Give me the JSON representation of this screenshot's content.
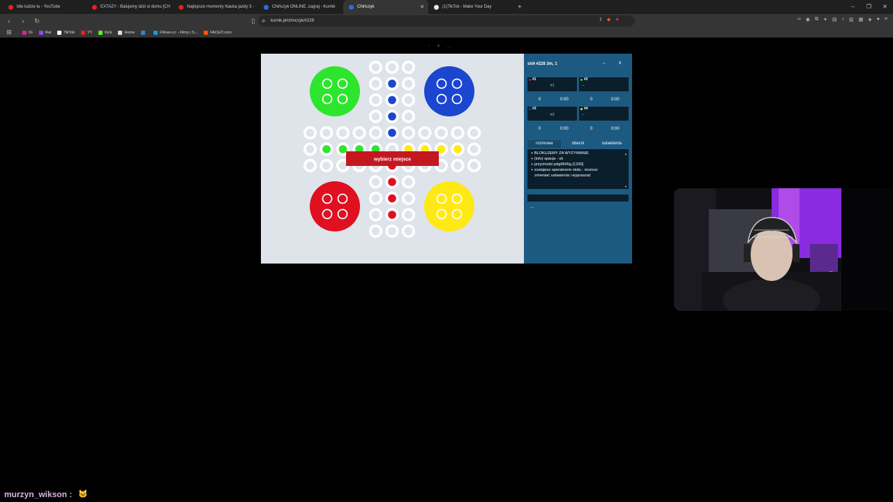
{
  "browser": {
    "tabs": [
      {
        "title": "tdw ludzie tu - YouTube",
        "color": "#e62117",
        "active": false
      },
      {
        "title": "EXTAZY - Balujemy dziś w domu [CH",
        "color": "#e62117",
        "active": false
      },
      {
        "title": "Najlepsze momenty Nauka jazdy 3 -",
        "color": "#e62117",
        "active": false
      },
      {
        "title": "Chińczyk ONLINE, zagraj - Kurnik",
        "color": "#2a6fdb",
        "active": false
      },
      {
        "title": "Chińczyk",
        "color": "#2a6fdb",
        "active": true
      },
      {
        "title": "(1)TikTok - Make Your Day",
        "color": "#ffffff",
        "active": false
      }
    ],
    "new_tab": "+",
    "window_controls": [
      "–",
      "❐",
      "✕"
    ],
    "url": "kurnik.pl/chinczyk/#228",
    "bookmarks": [
      {
        "label": "IG",
        "color": "#d6249f"
      },
      {
        "label": "Rat",
        "color": "#9146ff"
      },
      {
        "label": "TikTok",
        "color": "#ffffff"
      },
      {
        "label": "YT",
        "color": "#e62117"
      },
      {
        "label": "Kick",
        "color": "#53fc18"
      },
      {
        "label": "Home",
        "color": "#dddddd"
      },
      {
        "label": "",
        "color": "#3b82c4"
      },
      {
        "label": "Filman.cc - Filmy i S...",
        "color": "#1a9bd7"
      },
      {
        "label": "FACEIT.com",
        "color": "#ff5500"
      }
    ]
  },
  "page": {
    "zoom_controls": [
      "-",
      "+",
      "..."
    ]
  },
  "board": {
    "bases": {
      "green": "#2ee52e",
      "blue": "#1a46d0",
      "red": "#df1020",
      "yellow": "#ffe914"
    },
    "banner_label": "wybierz miejsce",
    "banner_color": "#c41820"
  },
  "panel": {
    "title": "stół #228   3m, 1",
    "minimize": "–",
    "close": "x",
    "seats": [
      {
        "id": "#1",
        "name": "#1",
        "dot": "#e02020",
        "score": "0",
        "time": "0:00"
      },
      {
        "id": "#2",
        "name": "--",
        "dot": "#2ee52e",
        "score": "0",
        "time": "0:00"
      },
      {
        "id": "#3",
        "name": "#3",
        "dot": "#1a46d0",
        "score": "0",
        "time": "0:00"
      },
      {
        "id": "#4",
        "name": "--",
        "dot": "#ffe914",
        "score": "0",
        "time": "0:00"
      }
    ],
    "tabs": [
      "rozmowa",
      "obecni",
      "ustawienia"
    ],
    "chat_lines": [
      "+ BLOKUJEMY ZA WYZYWANIE",
      "+ (info) spacja - ok",
      "+ przychodzi pdg9645g [1200]",
      "+ zostajesz operatorem stołu - możesz",
      "  zmieniać ustawienia i wypraszać"
    ],
    "more": "..."
  },
  "stream_chat": {
    "username": "murzyn_wikson :",
    "message": "🐱"
  }
}
